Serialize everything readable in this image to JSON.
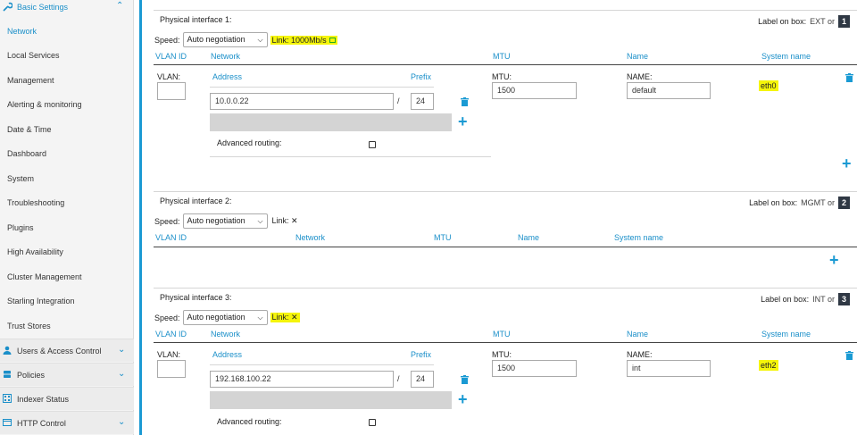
{
  "sidebar": {
    "header": "Basic Settings",
    "items": [
      "Network",
      "Local Services",
      "Management",
      "Alerting & monitoring",
      "Date & Time",
      "Dashboard",
      "System",
      "Troubleshooting",
      "Plugins",
      "High Availability",
      "Cluster Management",
      "Starling Integration",
      "Trust Stores"
    ],
    "groups": [
      "Users & Access Control",
      "Policies",
      "Indexer Status",
      "HTTP Control"
    ]
  },
  "colors": {
    "accent": "#1a8fc9",
    "highlight": "#f5f50a",
    "badge": "#2f3844"
  },
  "common": {
    "label_on_box": "Label on box:",
    "speed_label": "Speed:",
    "speed_value": "Auto negotiation",
    "vlan_id": "VLAN ID",
    "network": "Network",
    "mtu": "MTU",
    "name": "Name",
    "system_name": "System name",
    "vlan_field": "VLAN:",
    "address": "Address",
    "prefix": "Prefix",
    "mtu_field": "MTU:",
    "name_field": "NAME:",
    "advanced_routing": "Advanced routing:",
    "slash": "/"
  },
  "interfaces": [
    {
      "title": "Physical interface 1:",
      "box_label": "EXT or",
      "box_number": "1",
      "link": "Link: 1000Mb/s",
      "address": "10.0.0.22",
      "prefix": "24",
      "mtu": "1500",
      "name": "default",
      "system_name": "eth0"
    },
    {
      "title": "Physical interface 2:",
      "box_label": "MGMT or",
      "box_number": "2",
      "link": "Link: ✕"
    },
    {
      "title": "Physical interface 3:",
      "box_label": "INT or",
      "box_number": "3",
      "link": "Link: ✕",
      "address": "192.168.100.22",
      "prefix": "24",
      "mtu": "1500",
      "name": "int",
      "system_name": "eth2"
    }
  ]
}
